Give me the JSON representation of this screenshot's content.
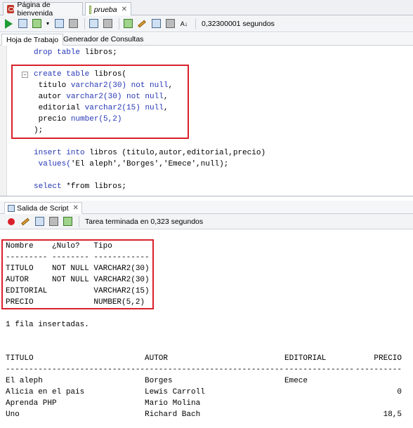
{
  "doc_tabs": [
    {
      "label": "Página de bienvenida",
      "icon": "oracle-icon"
    },
    {
      "label": "prueba",
      "icon": "sql-worksheet-icon"
    }
  ],
  "toolbar": {
    "elapsed": "0,32300001 segundos"
  },
  "worksheet_tabs": [
    "Hoja de Trabajo",
    "Generador de Consultas"
  ],
  "editor": {
    "lines": [
      {
        "k": "drop table",
        "t": " libros;"
      },
      {
        "k": "create table",
        "t": " libros("
      },
      {
        "a": " titulo ",
        "k": "varchar2(30) not null",
        "t": ","
      },
      {
        "a": " autor ",
        "k": "varchar2(30) not null",
        "t": ","
      },
      {
        "a": " editorial ",
        "k": "varchar2(15) null",
        "t": ","
      },
      {
        "a": " precio ",
        "k": "number(5,2)",
        "t": ""
      },
      {
        "a": "",
        "k": "",
        "t": ");"
      },
      {
        "k": "insert into",
        "t": " libros (titulo,autor,editorial,precio)"
      },
      {
        "a": " ",
        "k": "values(",
        "t": "'El aleph','Borges','Emece',null);"
      },
      {
        "k": "select",
        "t": " *from libros;"
      }
    ]
  },
  "output_tab": {
    "label": "Salida de Script"
  },
  "output_status": "Tarea terminada en 0,323 segundos",
  "describe": {
    "header": "Nombre    ¿Nulo?   Tipo",
    "rule": "--------- -------- ------------",
    "rows": [
      "TITULO    NOT NULL VARCHAR2(30)",
      "AUTOR     NOT NULL VARCHAR2(30)",
      "EDITORIAL          VARCHAR2(15)",
      "PRECIO             NUMBER(5,2)"
    ]
  },
  "insert_msg": "1 fila insertadas.",
  "results": {
    "columns": [
      "TITULO",
      "AUTOR",
      "EDITORIAL",
      "PRECIO"
    ],
    "rules": [
      "------------------------------",
      "------------------------------",
      "---------------",
      "----------"
    ],
    "rows": [
      [
        "El aleph",
        "Borges",
        "Emece",
        ""
      ],
      [
        "Alicia en el pais",
        "Lewis Carroll",
        "",
        "0"
      ],
      [
        "Aprenda PHP",
        "Mario Molina",
        "",
        ""
      ],
      [
        "Uno",
        "Richard Bach",
        "",
        "18,5"
      ]
    ]
  },
  "colors": {
    "highlight_box": "#d9202a",
    "keyword": "#2637b5"
  }
}
